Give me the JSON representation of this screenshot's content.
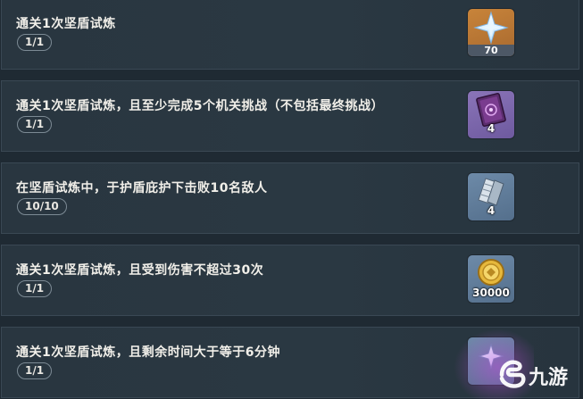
{
  "tasks": [
    {
      "title": "通关1次坚盾试炼",
      "progress": "1/1",
      "reward_icon": "primogem-icon",
      "reward_count": "70"
    },
    {
      "title": "通关1次坚盾试炼，且至少完成5个机关挑战（不包括最终挑战）",
      "progress": "1/1",
      "reward_icon": "heros-wit-book-icon",
      "reward_count": "4"
    },
    {
      "title": "在坚盾试炼中，于护盾庇护下击败10名敌人",
      "progress": "10/10",
      "reward_icon": "mystic-enhancement-ore-icon",
      "reward_count": "4"
    },
    {
      "title": "通关1次坚盾试炼，且受到伤害不超过30次",
      "progress": "1/1",
      "reward_icon": "mora-coin-icon",
      "reward_count": "30000"
    },
    {
      "title": "通关1次坚盾试炼，且剩余时间大于等于6分钟",
      "progress": "1/1",
      "reward_icon": "primogem-icon",
      "reward_count": ""
    }
  ],
  "watermark": {
    "text": "九游"
  },
  "colors": {
    "background": "#1f2a33",
    "row": "#293640",
    "gold_rarity": "#c8843a",
    "purple_rarity": "#8a74b8",
    "blue_rarity": "#6d8aa8"
  }
}
